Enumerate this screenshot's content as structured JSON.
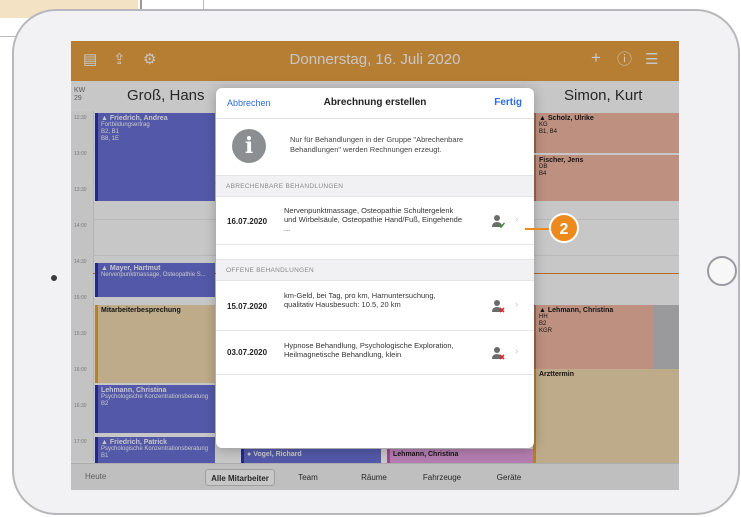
{
  "appbar": {
    "title": "Donnerstag, 16. Juli 2020",
    "icons": [
      "calendar-list-icon",
      "share-icon",
      "gear-icon",
      "plus-icon",
      "help-icon",
      "list-icon"
    ]
  },
  "calendar": {
    "week_label": "KW",
    "week_number": "29",
    "columns": [
      "Groß, Hans",
      "Simon, Kurt"
    ],
    "times": [
      "12:30",
      "13:00",
      "13:30",
      "14:00",
      "14:30",
      "15:00",
      "15:30",
      "16:00",
      "16:30",
      "17:00"
    ],
    "events": {
      "friedrich_andrea": {
        "name": "Friedrich, Andrea",
        "l1": "Fortbildungsertrag",
        "l2": "B2, B1",
        "l3": "B8, 1E"
      },
      "mayer_hartmut": {
        "name": "Mayer, Hartmut",
        "l1": "Nervenpunktmassage, Osteopathie S..."
      },
      "mitarbeiter": {
        "name": "Mitarbeiterbesprechung"
      },
      "lehmann_christina_left": {
        "name": "Lehmann, Christina",
        "l1": "Psychologische Konzentrationsberatung",
        "l2": "B2"
      },
      "friedrich_patrick": {
        "name": "Friedrich, Patrick",
        "l1": "Psychologische Konzentrationsberatung",
        "l2": "B1",
        "tag": "(14)"
      },
      "vogel_richard": {
        "name": "Vogel, Richard"
      },
      "lehmann_christina_bottom": {
        "name": "Lehmann, Christina"
      },
      "scholz_ulrike": {
        "name": "Scholz, Ulrike",
        "l1": "KG",
        "l2": "B1, B4",
        "tag": "(D/10)"
      },
      "fischer_jens": {
        "name": "Fischer, Jens",
        "l1": "DB",
        "l2": "B4",
        "tag": "(3/6)"
      },
      "lehmann_christina_right": {
        "name": "Lehmann, Christina",
        "l1": "HH",
        "l2": "B2",
        "l3": "KGR",
        "tag": "(6/6)"
      },
      "arzttermin": {
        "name": "Arzttermin"
      }
    }
  },
  "modal": {
    "cancel": "Abbrechen",
    "title": "Abrechnung erstellen",
    "done": "Fertig",
    "info_text": "Nur für Behandlungen in der Gruppe \"Abrechenbare Behandlungen\" werden Rechnungen erzeugt.",
    "section_billable": "ABRECHENBARE BEHANDLUNGEN",
    "billable": [
      {
        "date": "16.07.2020",
        "desc": "Nervenpunktmassage, Osteopathie Schultergelenk und Wirbelsäule, Osteopathie Hand/Fuß, Eingehende ...",
        "status": "billable",
        "color": "#3c8f3c"
      }
    ],
    "section_open": "OFFENE BEHANDLUNGEN",
    "open": [
      {
        "date": "15.07.2020",
        "desc": "km-Geld, bei Tag, pro km, Harnuntersuchung, qualitativ Hausbesuch: 10.5, 20 km",
        "status": "open",
        "color": "#d22f2f"
      },
      {
        "date": "03.07.2020",
        "desc": "Hypnose Behandlung, Psychologische Exploration, Heilmagnetische Behandlung, klein",
        "status": "open",
        "color": "#d22f2f"
      }
    ]
  },
  "tabbar": {
    "today": "Heute",
    "segments": [
      "Alle Mitarbeiter",
      "Team",
      "Räume",
      "Fahrzeuge",
      "Geräte"
    ],
    "active_segment": "Alle Mitarbeiter"
  },
  "callout": {
    "number": "2"
  },
  "colors": {
    "accent": "#e9a240",
    "link": "#2d6fd6",
    "callout": "#ec8a1e"
  }
}
